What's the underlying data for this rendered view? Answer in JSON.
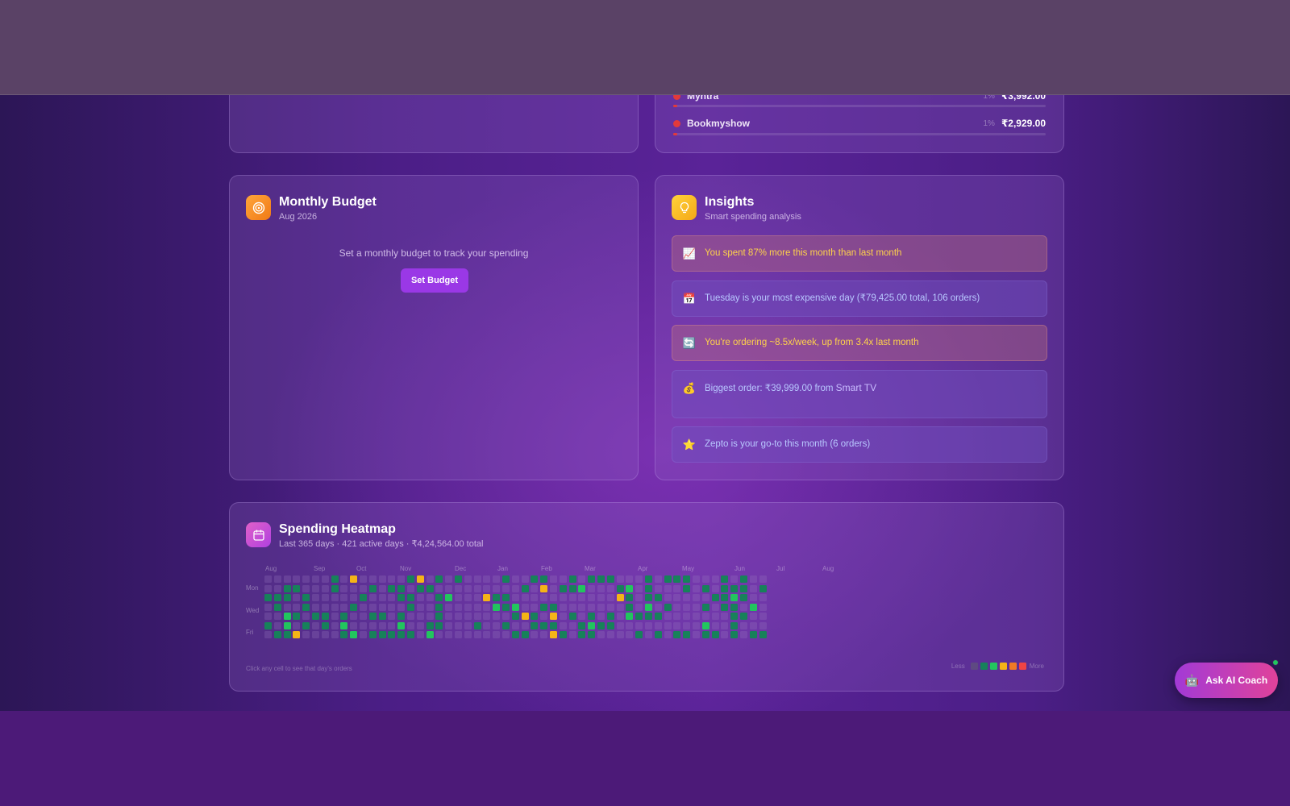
{
  "merchants": [
    {
      "name": "Myntra",
      "pct": "1%",
      "amount": "₹3,992.00",
      "share": 0.01
    },
    {
      "name": "Bookmyshow",
      "pct": "1%",
      "amount": "₹2,929.00",
      "share": 0.01
    }
  ],
  "budget": {
    "title": "Monthly Budget",
    "subtitle": "Aug 2026",
    "message": "Set a monthly budget to track your spending",
    "button_label": "Set Budget",
    "icon": "target-icon"
  },
  "insights": {
    "title": "Insights",
    "subtitle": "Smart spending analysis",
    "icon": "lightbulb-icon",
    "items": [
      {
        "icon": "chart-up-icon",
        "glyph": "📈",
        "text": "You spent 87% more this month than last month",
        "tone": "warn"
      },
      {
        "icon": "calendar-icon",
        "glyph": "📅",
        "text": "Tuesday is your most expensive day (₹79,425.00 total, 106 orders)",
        "tone": "info"
      },
      {
        "icon": "refresh-icon",
        "glyph": "🔄",
        "text": "You're ordering ~8.5x/week, up from 3.4x last month",
        "tone": "warn"
      },
      {
        "icon": "money-bag-icon",
        "glyph": "💰",
        "text": "Biggest order: ₹39,999.00 from",
        "link": "Smart TV",
        "tone": "info"
      },
      {
        "icon": "star-icon",
        "glyph": "⭐",
        "text": "Zepto is your go-to this month (6 orders)",
        "tone": "info"
      }
    ]
  },
  "heatmap": {
    "title": "Spending Heatmap",
    "subtitle": "Last 365 days · 421 active days · ₹4,24,564.00 total",
    "icon": "calendar-icon",
    "months": [
      "Aug",
      "Sep",
      "Oct",
      "Nov",
      "Dec",
      "Jan",
      "Feb",
      "Mar",
      "Apr",
      "May",
      "Jun",
      "Jul",
      "Aug"
    ],
    "days": [
      "Mon",
      "Wed",
      "Fri"
    ],
    "hint": "Click any cell to see that day's orders",
    "legend_less": "Less",
    "legend_more": "More",
    "legend_colors": [
      "#5e4a82",
      "#17815a",
      "#22c55e",
      "#f5b417",
      "#f07a26",
      "#ef4444"
    ]
  },
  "coach": {
    "label": "Ask AI Coach",
    "icon": "robot-icon"
  }
}
